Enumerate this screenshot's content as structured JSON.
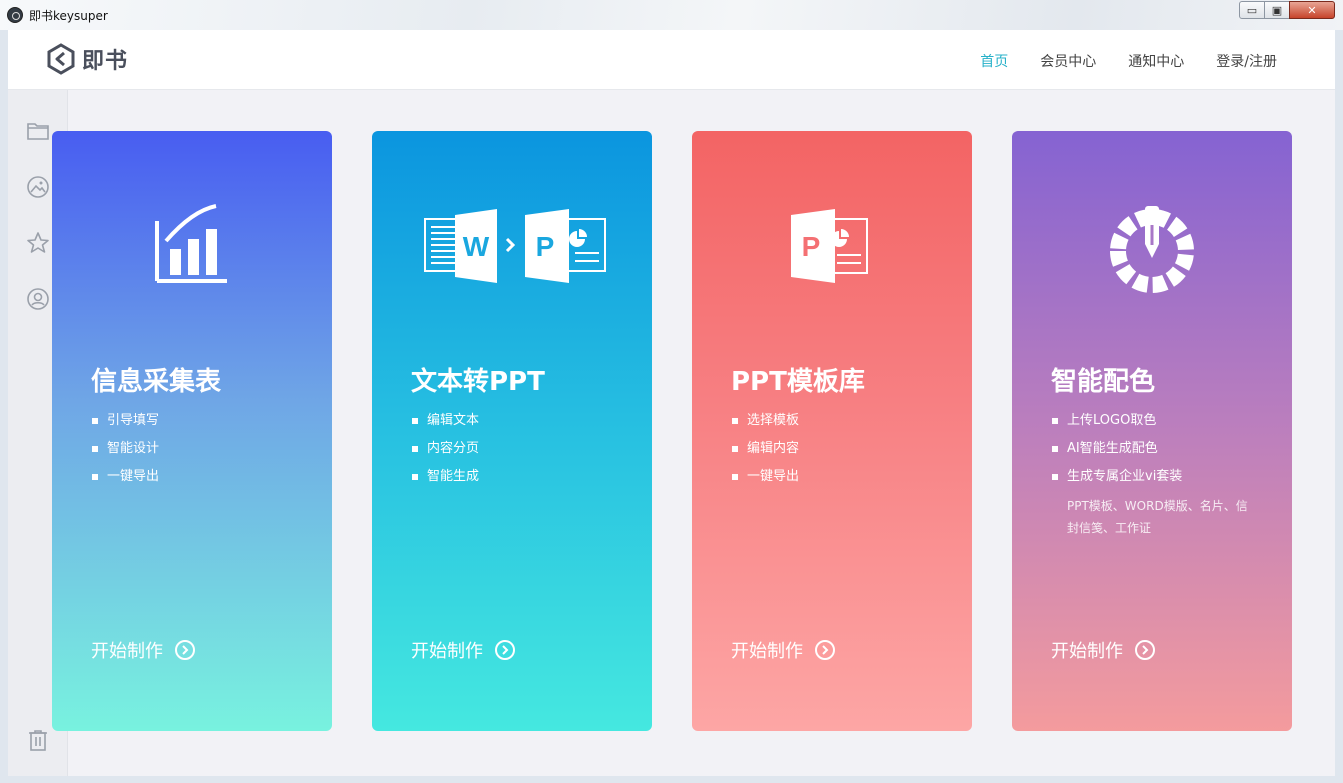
{
  "window": {
    "title": "即书keysuper",
    "minimize": "▭",
    "maximize": "▣",
    "close": "✕"
  },
  "header": {
    "logo_text": "即书",
    "nav": [
      {
        "label": "首页",
        "active": true
      },
      {
        "label": "会员中心",
        "active": false
      },
      {
        "label": "通知中心",
        "active": false
      },
      {
        "label": "登录/注册",
        "active": false
      }
    ]
  },
  "sidebar": {
    "icons": [
      "folder-icon",
      "image-icon",
      "star-icon",
      "user-icon",
      "trash-icon"
    ]
  },
  "cards": [
    {
      "title": "信息采集表",
      "features": [
        "引导填写",
        "智能设计",
        "一键导出"
      ],
      "action": "开始制作",
      "icon": "chart-icon"
    },
    {
      "title": "文本转PPT",
      "features": [
        "编辑文本",
        "内容分页",
        "智能生成"
      ],
      "action": "开始制作",
      "icon": "word-to-ppt-icon"
    },
    {
      "title": "PPT模板库",
      "features": [
        "选择模板",
        "编辑内容",
        "一键导出"
      ],
      "action": "开始制作",
      "icon": "powerpoint-icon"
    },
    {
      "title": "智能配色",
      "features": [
        "上传LOGO取色",
        "AI智能生成配色",
        "生成专属企业vi套装"
      ],
      "note": "PPT模板、WORD模版、名片、信封信笺、工作证",
      "action": "开始制作",
      "icon": "color-picker-icon"
    }
  ],
  "colors": {
    "accent": "#27b1c9",
    "card1": "#485df1",
    "card2": "#0b95df",
    "card3": "#f36464",
    "card4": "#8563d2"
  }
}
